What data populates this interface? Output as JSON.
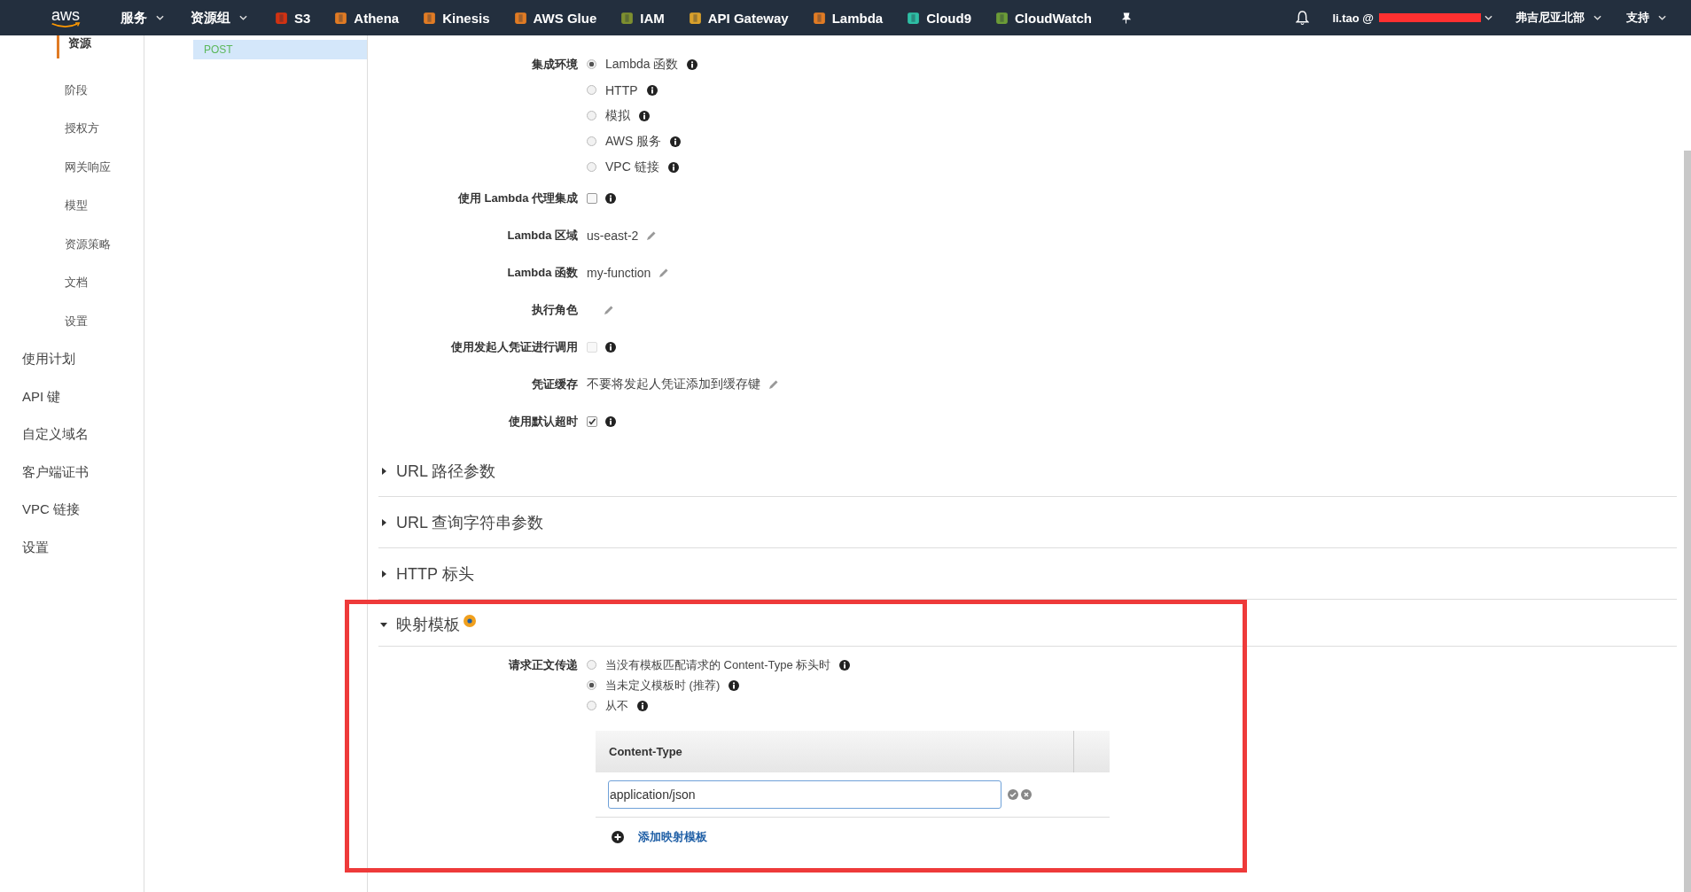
{
  "nav": {
    "logo": "aws",
    "menus": [
      {
        "label": "服务"
      },
      {
        "label": "资源组"
      }
    ],
    "services": [
      {
        "label": "S3",
        "color": "#d13212"
      },
      {
        "label": "Athena",
        "color": "#e07b24"
      },
      {
        "label": "Kinesis",
        "color": "#e07b24"
      },
      {
        "label": "AWS Glue",
        "color": "#e07b24"
      },
      {
        "label": "IAM",
        "color": "#7d8f2f"
      },
      {
        "label": "API Gateway",
        "color": "#d9a02b"
      },
      {
        "label": "Lambda",
        "color": "#e07b24"
      },
      {
        "label": "Cloud9",
        "color": "#2ebfa5"
      },
      {
        "label": "CloudWatch",
        "color": "#6b9b37"
      }
    ],
    "user": "li.tao @",
    "region": "弗吉尼亚北部",
    "support": "支持"
  },
  "sidebar": {
    "resource_items": [
      {
        "label": "资源",
        "selected": true
      },
      {
        "label": "阶段",
        "selected": false
      },
      {
        "label": "授权方",
        "selected": false
      },
      {
        "label": "网关响应",
        "selected": false
      },
      {
        "label": "模型",
        "selected": false
      },
      {
        "label": "资源策略",
        "selected": false
      },
      {
        "label": "文档",
        "selected": false
      },
      {
        "label": "设置",
        "selected": false
      }
    ],
    "items": [
      {
        "label": "使用计划"
      },
      {
        "label": "API 键"
      },
      {
        "label": "自定义域名"
      },
      {
        "label": "客户端证书"
      },
      {
        "label": "VPC 链接"
      },
      {
        "label": "设置"
      }
    ]
  },
  "resources": {
    "methods": [
      {
        "label": "POST",
        "selected": true
      }
    ]
  },
  "integration": {
    "label": "集成环境",
    "options": [
      {
        "label": "Lambda 函数",
        "selected": true
      },
      {
        "label": "HTTP",
        "selected": false
      },
      {
        "label": "模拟",
        "selected": false
      },
      {
        "label": "AWS 服务",
        "selected": false
      },
      {
        "label": "VPC 链接",
        "selected": false
      }
    ]
  },
  "fields": [
    {
      "kind": "checkbox",
      "label": "使用 Lambda 代理集成",
      "checked": false,
      "disabled": false
    },
    {
      "kind": "value",
      "label": "Lambda 区域",
      "value": "us-east-2"
    },
    {
      "kind": "value",
      "label": "Lambda 函数",
      "value": "my-function"
    },
    {
      "kind": "value",
      "label": "执行角色"
    },
    {
      "kind": "checkbox",
      "label": "使用发起人凭证进行调用",
      "checked": false,
      "disabled": true
    },
    {
      "kind": "value",
      "label": "凭证缓存",
      "value": "不要将发起人凭证添加到缓存键"
    },
    {
      "kind": "checkbox",
      "label": "使用默认超时",
      "checked": true,
      "disabled": false
    }
  ],
  "sections": [
    {
      "title": "URL 路径参数",
      "expanded": false,
      "indicator": false
    },
    {
      "title": "URL 查询字符串参数",
      "expanded": false,
      "indicator": false
    },
    {
      "title": "HTTP 标头",
      "expanded": false,
      "indicator": false
    },
    {
      "title": "映射模板",
      "expanded": true,
      "indicator": true
    }
  ],
  "mapping": {
    "label": "请求正文传递",
    "options": [
      {
        "label": "当没有模板匹配请求的 Content-Type 标头时",
        "selected": false
      },
      {
        "label": "当未定义模板时 (推荐)",
        "selected": true
      },
      {
        "label": "从不",
        "selected": false
      }
    ],
    "table": {
      "column": "Content-Type",
      "input_value": "application/json"
    },
    "add_link": "添加映射模板"
  }
}
